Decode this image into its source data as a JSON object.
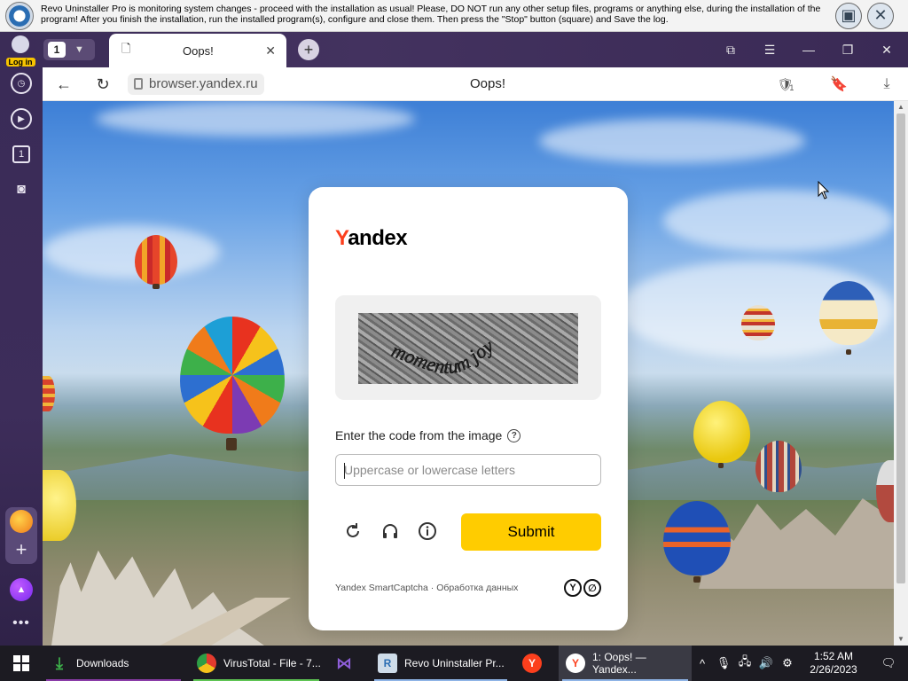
{
  "revo": {
    "message": "Revo Uninstaller Pro is monitoring system changes - proceed with the installation as usual! Please, DO NOT run any other setup files, programs or anything else, during the installation of the program! After you finish the installation, run the installed program(s), configure and close them. Then press the \"Stop\" button (square) and Save the log."
  },
  "browser": {
    "login_label": "Log in",
    "tab_count": "1",
    "tab": {
      "title": "Oops!"
    },
    "address": {
      "url": "browser.yandex.ru",
      "page_title": "Oops!",
      "protect_badge": "1"
    }
  },
  "sidebar": {
    "tabs_badge": "1"
  },
  "captcha": {
    "logo_y": "Y",
    "logo_rest": "andex",
    "captcha_text": "momentum joy",
    "prompt": "Enter the code from the image",
    "placeholder": "Uppercase or lowercase letters",
    "input_value": "",
    "submit": "Submit",
    "footer": "Yandex SmartCaptcha · Обработка данных"
  },
  "taskbar": {
    "items": [
      {
        "label": "Downloads"
      },
      {
        "label": "VirusTotal - File - 7..."
      },
      {
        "label": ""
      },
      {
        "label": "Revo Uninstaller Pr..."
      },
      {
        "label": ""
      },
      {
        "label": "1: Oops! — Yandex..."
      }
    ],
    "time": "1:52 AM",
    "date": "2/26/2023"
  },
  "colors": {
    "accent_yellow": "#ffcc00",
    "yandex_red": "#fc3f1d",
    "browser_frame": "#3b2c57"
  }
}
